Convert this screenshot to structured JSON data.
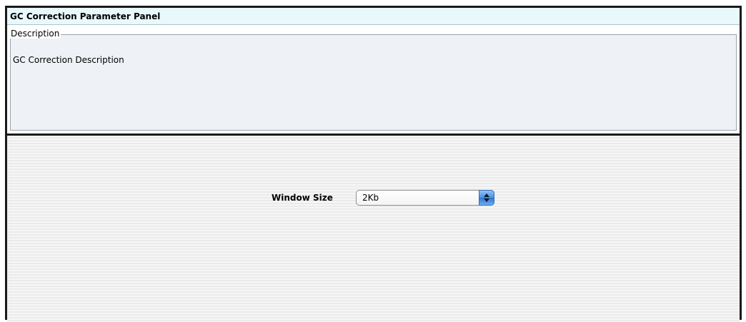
{
  "panel": {
    "title": "GC Correction Parameter Panel"
  },
  "description": {
    "legend": "Description",
    "text": "GC Correction Description"
  },
  "parameters": {
    "window_size": {
      "label": "Window Size",
      "value": "2Kb",
      "icon": "up-down-arrows-icon"
    }
  },
  "colors": {
    "title_bar_bg": "#e9f8fb",
    "description_bg": "#eef1f5",
    "select_accent": "#4b90e0",
    "frame_border": "#1a1a1a"
  }
}
